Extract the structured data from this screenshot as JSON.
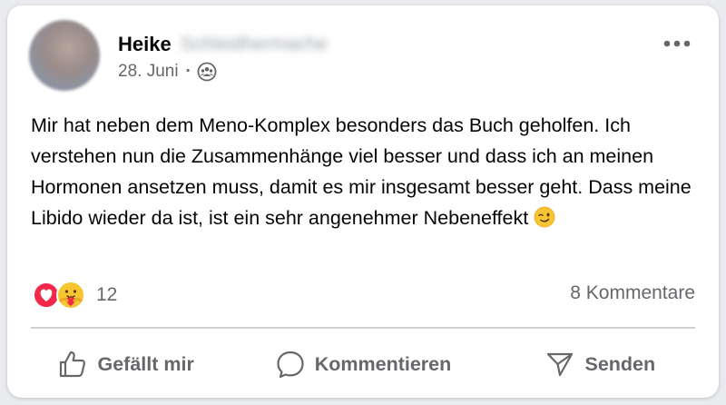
{
  "author": {
    "first_name": "Heike",
    "last_name": "Schleidhermache"
  },
  "meta": {
    "date": "28. Juni",
    "separator": "·",
    "audience_icon": "group-icon"
  },
  "post": {
    "text": "Mir hat neben dem Meno-Komplex besonders das Buch geholfen. Ich verstehen nun die Zusammenhänge viel besser und dass ich an meinen Hormonen ansetzen muss, damit es mir insgesamt besser geht. Dass meine Libido wieder da ist, ist ein sehr angenehmer Nebeneffekt",
    "emoji": "winking-face-icon"
  },
  "stats": {
    "reaction_icons": [
      "love-reaction-icon",
      "care-reaction-icon"
    ],
    "reaction_count": "12",
    "comments_label": "8 Kommentare"
  },
  "actions": {
    "like_label": "Gefällt mir",
    "comment_label": "Kommentieren",
    "send_label": "Senden"
  },
  "colors": {
    "text_primary": "#050505",
    "text_secondary": "#65676b",
    "love_red": "#f02849",
    "divider": "#ced0d4"
  }
}
